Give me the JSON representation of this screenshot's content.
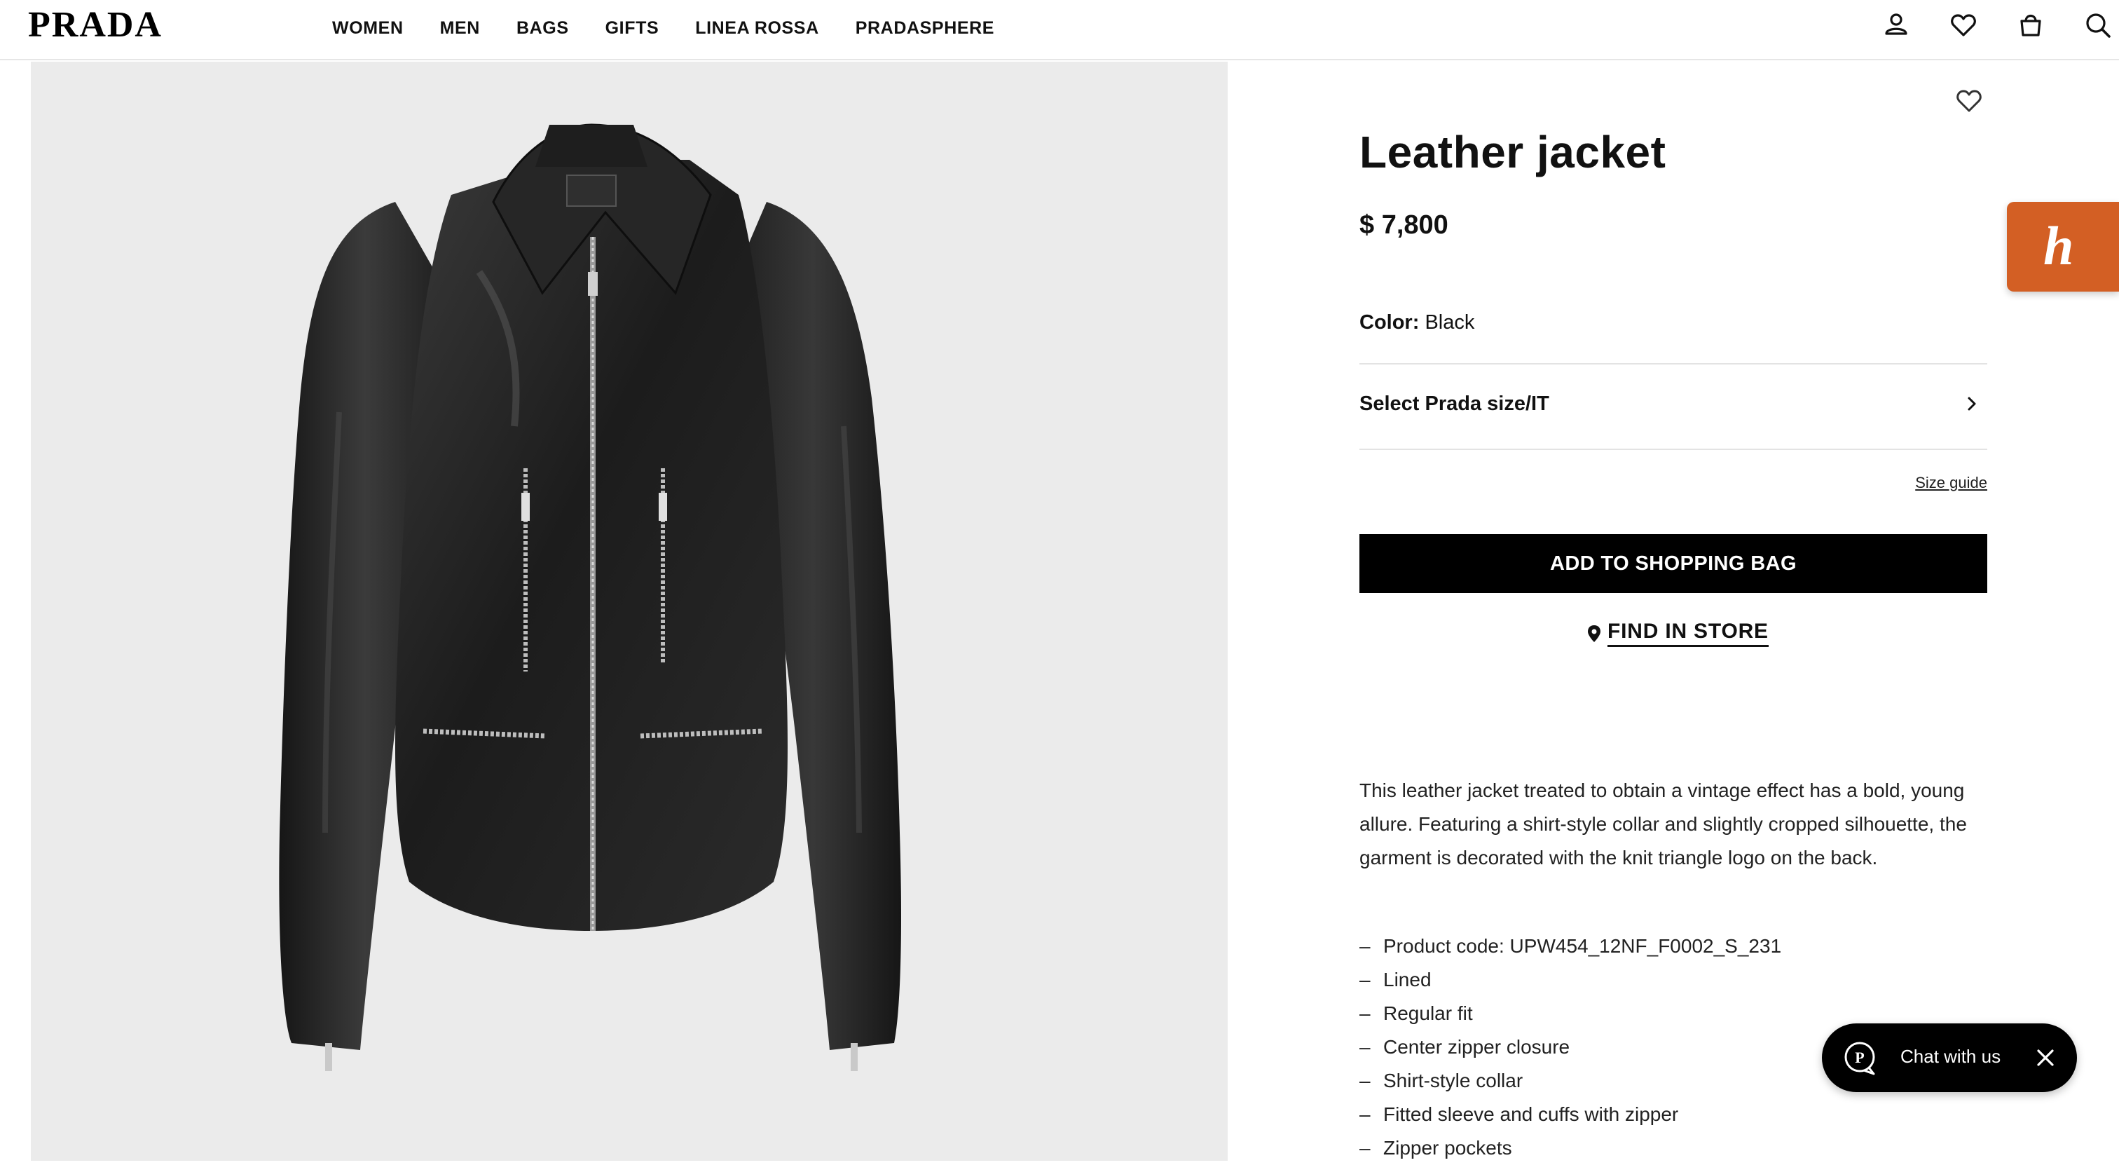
{
  "header": {
    "logo": "PRADA",
    "nav": [
      "WOMEN",
      "MEN",
      "BAGS",
      "GIFTS",
      "LINEA ROSSA",
      "PRADASPHERE"
    ],
    "icons": [
      "account-icon",
      "wishlist-icon",
      "shopping-bag-icon",
      "search-icon"
    ]
  },
  "product": {
    "title": "Leather jacket",
    "price": "$ 7,800",
    "color_label": "Color:",
    "color_value": "Black",
    "size_select_label": "Select Prada size/IT",
    "size_guide": "Size guide",
    "add_to_bag": "ADD TO SHOPPING BAG",
    "find_in_store": "FIND IN STORE",
    "description": "This leather jacket treated to obtain a vintage effect has a bold, young allure. Featuring a shirt-style collar and slightly cropped silhouette, the garment is decorated with the knit triangle logo on the back.",
    "features": [
      "Product code: UPW454_12NF_F0002_S_231",
      "Lined",
      "Regular fit",
      "Center zipper closure",
      "Shirt-style collar",
      "Fitted sleeve and cuffs with zipper",
      "Zipper pockets"
    ],
    "feature_dash": "–"
  },
  "honey": {
    "glyph": "h"
  },
  "chat": {
    "label": "Chat with us"
  },
  "colors": {
    "brand_honey": "#d35f24",
    "button_black": "#000000",
    "image_bg": "#ebebeb"
  }
}
